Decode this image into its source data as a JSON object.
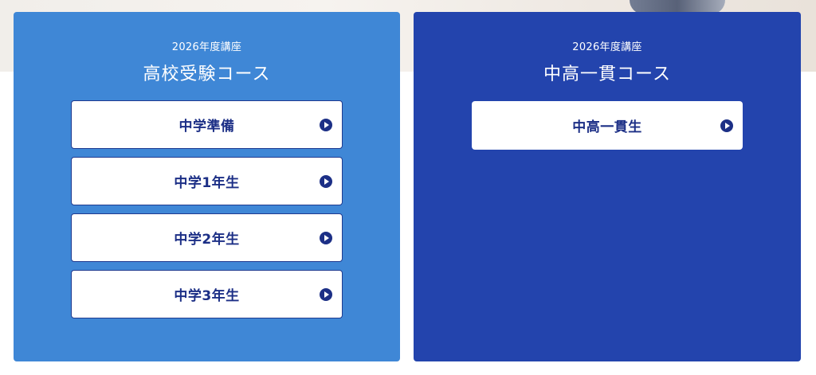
{
  "courses": [
    {
      "year_label": "2026年度講座",
      "title": "高校受験コース",
      "buttons": [
        {
          "label": "中学準備"
        },
        {
          "label": "中学1年生"
        },
        {
          "label": "中学2年生"
        },
        {
          "label": "中学3年生"
        }
      ]
    },
    {
      "year_label": "2026年度講座",
      "title": "中高一貫コース",
      "buttons": [
        {
          "label": "中高一貫生"
        }
      ]
    }
  ],
  "colors": {
    "left_card": "#3f87d6",
    "right_card": "#2344ad",
    "button_text": "#1c2f86",
    "button_bg": "#ffffff"
  },
  "icons": {
    "button_arrow": "play-circle-icon"
  }
}
